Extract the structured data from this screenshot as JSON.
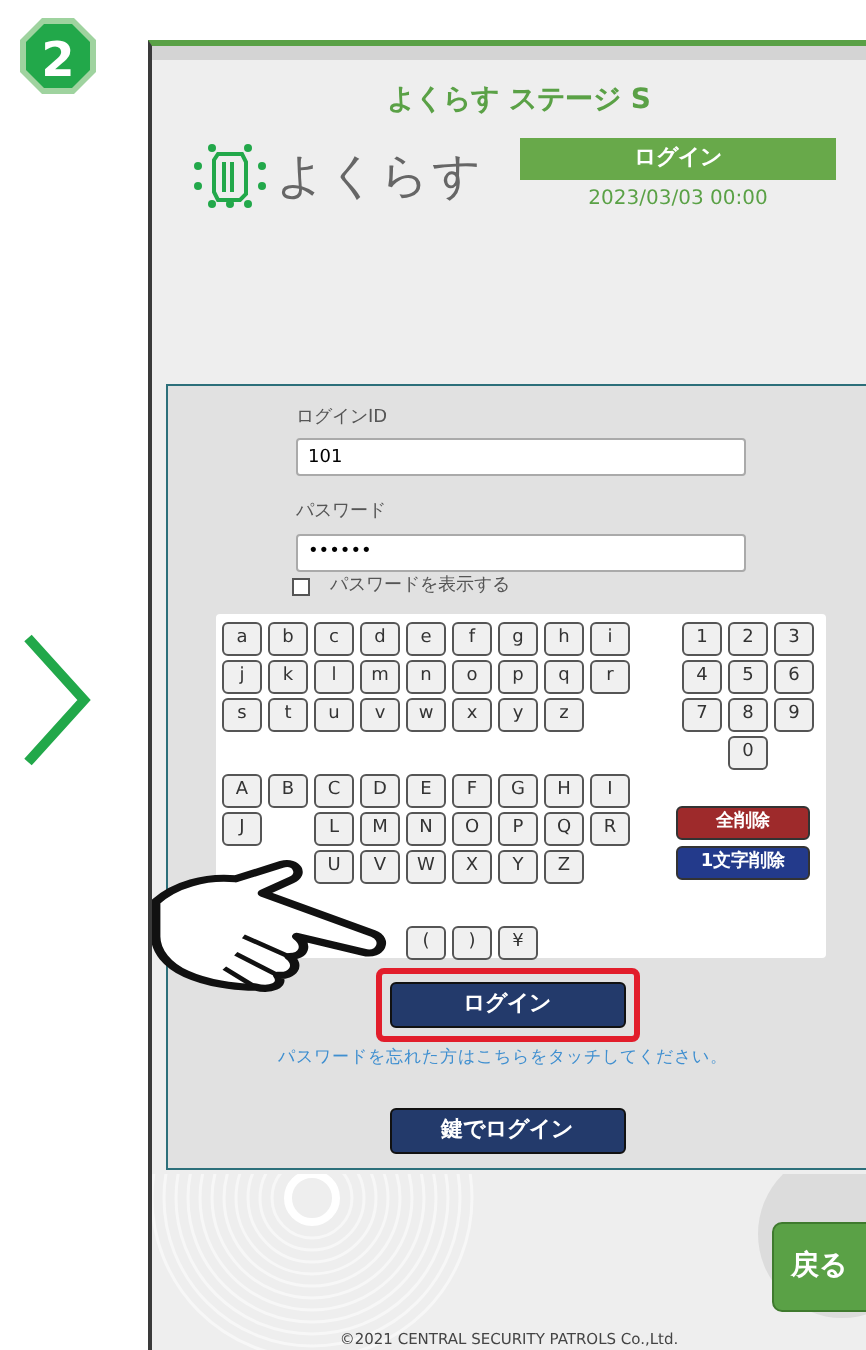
{
  "step_badge": "2",
  "app_title": "よくらす ステージ S",
  "logo_text": "よくらす",
  "header": {
    "label": "ログイン",
    "datetime": "2023/03/03 00:00"
  },
  "form": {
    "login_id": {
      "label": "ログインID",
      "value": "101"
    },
    "password": {
      "label": "パスワード",
      "value": "••••••"
    },
    "show_password": {
      "label": "パスワードを表示する",
      "checked": false
    }
  },
  "keyboard": {
    "letter_rows": [
      [
        {
          "kind": "key",
          "label": "a"
        },
        {
          "kind": "key",
          "label": "b"
        },
        {
          "kind": "key",
          "label": "c"
        },
        {
          "kind": "key",
          "label": "d"
        },
        {
          "kind": "key",
          "label": "e"
        },
        {
          "kind": "key",
          "label": "f"
        },
        {
          "kind": "key",
          "label": "g"
        },
        {
          "kind": "key",
          "label": "h"
        },
        {
          "kind": "key",
          "label": "i"
        }
      ],
      [
        {
          "kind": "key",
          "label": "j"
        },
        {
          "kind": "key",
          "label": "k"
        },
        {
          "kind": "key",
          "label": "l"
        },
        {
          "kind": "key",
          "label": "m"
        },
        {
          "kind": "key",
          "label": "n"
        },
        {
          "kind": "key",
          "label": "o"
        },
        {
          "kind": "key",
          "label": "p"
        },
        {
          "kind": "key",
          "label": "q"
        },
        {
          "kind": "key",
          "label": "r"
        }
      ],
      [
        {
          "kind": "key",
          "label": "s"
        },
        {
          "kind": "key",
          "label": "t"
        },
        {
          "kind": "key",
          "label": "u"
        },
        {
          "kind": "key",
          "label": "v"
        },
        {
          "kind": "key",
          "label": "w"
        },
        {
          "kind": "key",
          "label": "x"
        },
        {
          "kind": "key",
          "label": "y"
        },
        {
          "kind": "key",
          "label": "z"
        }
      ],
      [],
      [
        {
          "kind": "key",
          "label": "A"
        },
        {
          "kind": "key",
          "label": "B"
        },
        {
          "kind": "key",
          "label": "C"
        },
        {
          "kind": "key",
          "label": "D"
        },
        {
          "kind": "key",
          "label": "E"
        },
        {
          "kind": "key",
          "label": "F"
        },
        {
          "kind": "key",
          "label": "G"
        },
        {
          "kind": "key",
          "label": "H"
        },
        {
          "kind": "key",
          "label": "I"
        }
      ],
      [
        {
          "kind": "key",
          "label": "J"
        },
        {
          "kind": "covered"
        },
        {
          "kind": "key",
          "label": "L"
        },
        {
          "kind": "key",
          "label": "M"
        },
        {
          "kind": "key",
          "label": "N"
        },
        {
          "kind": "key",
          "label": "O"
        },
        {
          "kind": "key",
          "label": "P"
        },
        {
          "kind": "key",
          "label": "Q"
        },
        {
          "kind": "key",
          "label": "R"
        }
      ],
      [
        {
          "kind": "covered"
        },
        {
          "kind": "covered"
        },
        {
          "kind": "key",
          "label": "U"
        },
        {
          "kind": "key",
          "label": "V"
        },
        {
          "kind": "key",
          "label": "W"
        },
        {
          "kind": "key",
          "label": "X"
        },
        {
          "kind": "key",
          "label": "Y"
        },
        {
          "kind": "key",
          "label": "Z"
        }
      ],
      [],
      [
        {
          "kind": "covered"
        },
        {
          "kind": "covered"
        },
        {
          "kind": "covered"
        },
        {
          "kind": "covered"
        },
        {
          "kind": "key",
          "label": "("
        },
        {
          "kind": "key",
          "label": ")"
        },
        {
          "kind": "key",
          "label": "¥"
        }
      ]
    ],
    "number_rows": [
      [
        "1",
        "2",
        "3"
      ],
      [
        "4",
        "5",
        "6"
      ],
      [
        "7",
        "8",
        "9"
      ],
      [
        "0"
      ]
    ],
    "clear_all": "全削除",
    "backspace": "1文字削除"
  },
  "login_button": {
    "label": "ログイン",
    "highlighted": true
  },
  "forgot_link": "パスワードを忘れた方はこちらをタッチしてください。",
  "key_login_button": "鍵でログイン",
  "back_button": "戻る",
  "copyright": "©2021 CENTRAL SECURITY PATROLS Co.,Ltd."
}
